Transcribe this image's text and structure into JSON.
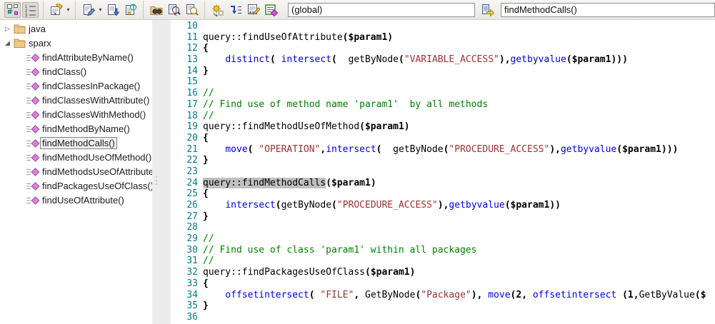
{
  "toolbar": {
    "groups": [
      {
        "icons": [
          {
            "name": "model-trace-icon",
            "toggled": true
          },
          {
            "name": "numbered-list-icon",
            "toggled": true
          }
        ]
      },
      {
        "icons": [
          {
            "name": "form-edit-icon",
            "dropdown": true
          }
        ]
      },
      {
        "icons": [
          {
            "name": "page-edit-icon",
            "dropdown": true
          },
          {
            "name": "page-import-icon"
          },
          {
            "name": "page-tag-icon"
          }
        ]
      },
      {
        "icons": [
          {
            "name": "folder-search-icon"
          },
          {
            "name": "page-search-red-icon"
          },
          {
            "name": "page-search-icon"
          }
        ]
      },
      {
        "icons": [
          {
            "name": "run-transform-icon"
          },
          {
            "name": "step-into-icon"
          },
          {
            "name": "script-edit-icon"
          },
          {
            "name": "list-diamond-icon"
          }
        ]
      }
    ],
    "scope_field": {
      "value": "(global)"
    },
    "go_button": {
      "icon": "page-forward-icon"
    },
    "name_field": {
      "value": "findMethodCalls()"
    }
  },
  "tree": {
    "folders": [
      {
        "label": "java",
        "expanded": false,
        "items": []
      },
      {
        "label": "sparx",
        "expanded": true,
        "items": [
          {
            "label": "findAttributeByName()"
          },
          {
            "label": "findClass()"
          },
          {
            "label": "findClassesInPackage()"
          },
          {
            "label": "findClassesWithAttribute()"
          },
          {
            "label": "findClassesWithMethod()"
          },
          {
            "label": "findMethodByName()"
          },
          {
            "label": "findMethodCalls()",
            "selected": true
          },
          {
            "label": "findMethodUseOfMethod()"
          },
          {
            "label": "findMethodsUseOfAttribute"
          },
          {
            "label": "findPackagesUseOfClass()"
          },
          {
            "label": "findUseOfAttribute()"
          }
        ]
      }
    ]
  },
  "editor": {
    "lines": [
      {
        "num": 10,
        "tokens": []
      },
      {
        "num": 11,
        "tokens": [
          {
            "s": "plain",
            "t": "query::findUseOfAttribute"
          },
          {
            "s": "op",
            "t": "("
          },
          {
            "s": "param",
            "t": "$param1"
          },
          {
            "s": "op",
            "t": ")"
          }
        ]
      },
      {
        "num": 12,
        "tokens": [
          {
            "s": "op",
            "t": "{"
          }
        ]
      },
      {
        "num": 13,
        "tokens": [
          {
            "s": "plain",
            "t": "    "
          },
          {
            "s": "kw",
            "t": "distinct"
          },
          {
            "s": "op",
            "t": "("
          },
          {
            "s": "plain",
            "t": " "
          },
          {
            "s": "kw",
            "t": "intersect"
          },
          {
            "s": "op",
            "t": "("
          },
          {
            "s": "plain",
            "t": "  "
          },
          {
            "s": "plain",
            "t": "getByNode"
          },
          {
            "s": "op",
            "t": "("
          },
          {
            "s": "str",
            "t": "\"VARIABLE_ACCESS\""
          },
          {
            "s": "op",
            "t": "),"
          },
          {
            "s": "kw",
            "t": "getbyvalue"
          },
          {
            "s": "op",
            "t": "("
          },
          {
            "s": "param",
            "t": "$param1"
          },
          {
            "s": "op",
            "t": ")))"
          }
        ]
      },
      {
        "num": 14,
        "tokens": [
          {
            "s": "op",
            "t": "}"
          }
        ]
      },
      {
        "num": 15,
        "tokens": []
      },
      {
        "num": 16,
        "tokens": [
          {
            "s": "cmt",
            "t": "//"
          }
        ]
      },
      {
        "num": 17,
        "tokens": [
          {
            "s": "cmt",
            "t": "// Find use of method name 'param1'  by all methods"
          }
        ]
      },
      {
        "num": 18,
        "tokens": [
          {
            "s": "cmt",
            "t": "//"
          }
        ]
      },
      {
        "num": 19,
        "tokens": [
          {
            "s": "plain",
            "t": "query::findMethodUseOfMethod"
          },
          {
            "s": "op",
            "t": "("
          },
          {
            "s": "param",
            "t": "$param1"
          },
          {
            "s": "op",
            "t": ")"
          }
        ]
      },
      {
        "num": 20,
        "tokens": [
          {
            "s": "op",
            "t": "{"
          }
        ]
      },
      {
        "num": 21,
        "tokens": [
          {
            "s": "plain",
            "t": "    "
          },
          {
            "s": "kw",
            "t": "move"
          },
          {
            "s": "op",
            "t": "("
          },
          {
            "s": "plain",
            "t": " "
          },
          {
            "s": "str",
            "t": "\"OPERATION\""
          },
          {
            "s": "op",
            "t": ","
          },
          {
            "s": "kw",
            "t": "intersect"
          },
          {
            "s": "op",
            "t": "("
          },
          {
            "s": "plain",
            "t": "  "
          },
          {
            "s": "plain",
            "t": "getByNode"
          },
          {
            "s": "op",
            "t": "("
          },
          {
            "s": "str",
            "t": "\"PROCEDURE_ACCESS\""
          },
          {
            "s": "op",
            "t": "),"
          },
          {
            "s": "kw",
            "t": "getbyvalue"
          },
          {
            "s": "op",
            "t": "("
          },
          {
            "s": "param",
            "t": "$param1"
          },
          {
            "s": "op",
            "t": ")))"
          }
        ]
      },
      {
        "num": 22,
        "tokens": [
          {
            "s": "op",
            "t": "}"
          }
        ]
      },
      {
        "num": 23,
        "tokens": []
      },
      {
        "num": 24,
        "tokens": [
          {
            "s": "hl",
            "t": "query::findMethodCalls"
          },
          {
            "s": "op",
            "t": "("
          },
          {
            "s": "param",
            "t": "$param1"
          },
          {
            "s": "op",
            "t": ")"
          }
        ]
      },
      {
        "num": 25,
        "tokens": [
          {
            "s": "op",
            "t": "{"
          }
        ]
      },
      {
        "num": 26,
        "tokens": [
          {
            "s": "plain",
            "t": "    "
          },
          {
            "s": "kw",
            "t": "intersect"
          },
          {
            "s": "op",
            "t": "("
          },
          {
            "s": "plain",
            "t": "getByNode"
          },
          {
            "s": "op",
            "t": "("
          },
          {
            "s": "str",
            "t": "\"PROCEDURE_ACCESS\""
          },
          {
            "s": "op",
            "t": "),"
          },
          {
            "s": "kw",
            "t": "getbyvalue"
          },
          {
            "s": "op",
            "t": "("
          },
          {
            "s": "param",
            "t": "$param1"
          },
          {
            "s": "op",
            "t": "))"
          }
        ]
      },
      {
        "num": 27,
        "tokens": [
          {
            "s": "op",
            "t": "}"
          }
        ]
      },
      {
        "num": 28,
        "tokens": []
      },
      {
        "num": 29,
        "tokens": [
          {
            "s": "cmt",
            "t": "//"
          }
        ]
      },
      {
        "num": 30,
        "tokens": [
          {
            "s": "cmt",
            "t": "// Find use of class 'param1' within all packages"
          }
        ]
      },
      {
        "num": 31,
        "tokens": [
          {
            "s": "cmt",
            "t": "//"
          }
        ]
      },
      {
        "num": 32,
        "tokens": [
          {
            "s": "plain",
            "t": "query::findPackagesUseOfClass"
          },
          {
            "s": "op",
            "t": "("
          },
          {
            "s": "param",
            "t": "$param1"
          },
          {
            "s": "op",
            "t": ")"
          }
        ]
      },
      {
        "num": 33,
        "tokens": [
          {
            "s": "op",
            "t": "{"
          }
        ]
      },
      {
        "num": 34,
        "tokens": [
          {
            "s": "plain",
            "t": "    "
          },
          {
            "s": "kw",
            "t": "offsetintersect"
          },
          {
            "s": "op",
            "t": "("
          },
          {
            "s": "plain",
            "t": " "
          },
          {
            "s": "str",
            "t": "\"FILE\""
          },
          {
            "s": "op",
            "t": ","
          },
          {
            "s": "plain",
            "t": " "
          },
          {
            "s": "plain",
            "t": "GetByNode"
          },
          {
            "s": "op",
            "t": "("
          },
          {
            "s": "str",
            "t": "\"Package\""
          },
          {
            "s": "op",
            "t": "),"
          },
          {
            "s": "plain",
            "t": " "
          },
          {
            "s": "kw",
            "t": "move"
          },
          {
            "s": "op",
            "t": "("
          },
          {
            "s": "param",
            "t": "2"
          },
          {
            "s": "op",
            "t": ","
          },
          {
            "s": "plain",
            "t": " "
          },
          {
            "s": "kw",
            "t": "offsetintersect"
          },
          {
            "s": "plain",
            "t": " "
          },
          {
            "s": "op",
            "t": "("
          },
          {
            "s": "param",
            "t": "1"
          },
          {
            "s": "op",
            "t": ","
          },
          {
            "s": "plain",
            "t": "GetByValue"
          },
          {
            "s": "op",
            "t": "("
          },
          {
            "s": "param",
            "t": "$"
          }
        ]
      },
      {
        "num": 35,
        "tokens": [
          {
            "s": "op",
            "t": "}"
          }
        ]
      },
      {
        "num": 36,
        "tokens": []
      }
    ]
  },
  "colors": {
    "keyword": "#0000e6",
    "string": "#993333",
    "comment": "#008000",
    "line_number": "#008080",
    "selection": "#c0c0c0",
    "folder": "#efc989",
    "method_diamond": "#d883d8"
  }
}
